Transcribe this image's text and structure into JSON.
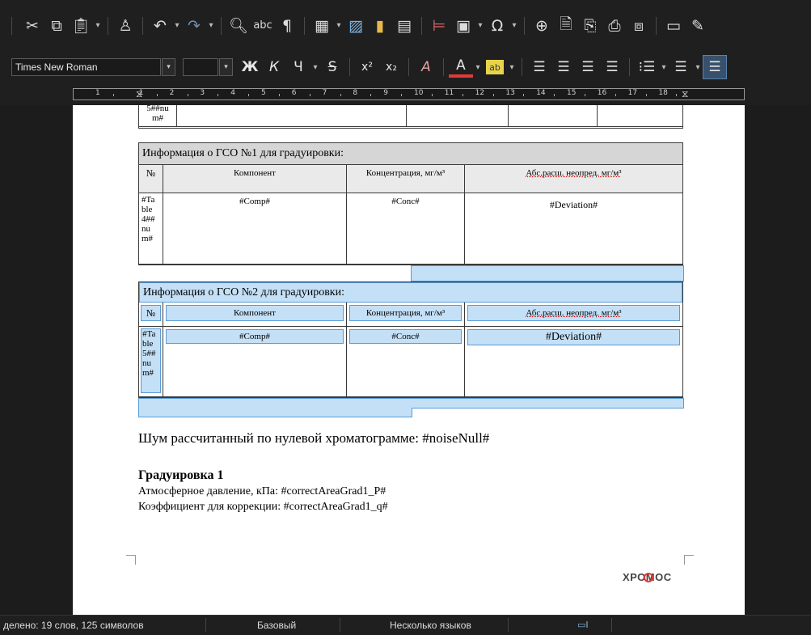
{
  "toolbar": {
    "font_name": "Times New Roman",
    "bold": "Ж",
    "italic": "К",
    "underline": "Ч",
    "strike": "S",
    "superscript": "x²",
    "subscript": "x₂",
    "font_color_letter": "A",
    "highlight_letter": "ab",
    "spellcheck": "abc",
    "pilcrow": "¶",
    "omega": "Ω"
  },
  "ruler": {
    "numbers": [
      "1",
      "1",
      "2",
      "3",
      "4",
      "5",
      "6",
      "7",
      "8",
      "9",
      "10",
      "11",
      "12",
      "13",
      "14",
      "15",
      "16",
      "17",
      "18"
    ]
  },
  "document": {
    "prev_table_tail": "5##nu\nm#",
    "table1": {
      "caption": "Информация о ГСО №1 для градуировки:",
      "headers": [
        "№",
        "Компонент",
        "Концентрация, мг/м³",
        "Абс.расш. неопред. мг/м³"
      ],
      "row": [
        "#Ta\nble\n4##\nnu\nm#",
        "#Comp#",
        "#Conc#",
        "#Deviation#"
      ]
    },
    "table2": {
      "caption": "Информация о ГСО №2 для градуировки:",
      "headers": [
        "№",
        "Компонент",
        "Концентрация, мг/м³",
        "Абс.расш. неопред. мг/м³"
      ],
      "row": [
        "#Ta\nble\n5##\nnu\nm#",
        "#Comp#",
        "#Conc#",
        "#Deviation#"
      ]
    },
    "noise_line": "Шум рассчитанный по нулевой хроматограмме: #noiseNull#",
    "grad_title": "Градуировка 1",
    "pressure_line": "Атмосферное давление, кПа: #correctAreaGrad1_P#",
    "coef_line": "Коэффициент для коррекции: #correctAreaGrad1_q#",
    "footer_logo": "ХРОМОС"
  },
  "statusbar": {
    "selection": "делено: 19 слов, 125 символов",
    "style": "Базовый",
    "language": "Несколько языков"
  }
}
